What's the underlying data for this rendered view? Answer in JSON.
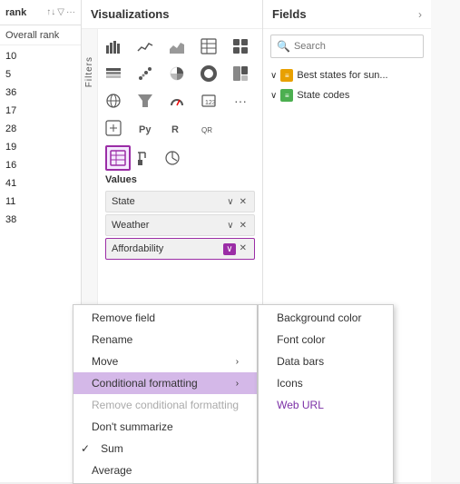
{
  "rank_panel": {
    "title": "rank",
    "subheader": "Overall rank",
    "values": [
      "10",
      "5",
      "36",
      "17",
      "28",
      "19",
      "16",
      "41",
      "11",
      "38"
    ]
  },
  "vis_panel": {
    "title": "Visualizations",
    "filters_label": "Filters",
    "values_label": "Values",
    "fields": [
      {
        "name": "State",
        "has_context": false
      },
      {
        "name": "Weather",
        "has_context": false
      },
      {
        "name": "Affordability",
        "has_context": true
      }
    ]
  },
  "fields_panel": {
    "title": "Fields",
    "search_placeholder": "Search",
    "groups": [
      {
        "label": "Best states for sun...",
        "icon_color": "#e8a000",
        "expanded": true,
        "subitems": []
      },
      {
        "label": "State codes",
        "icon_color": "#4CAF50",
        "expanded": false,
        "subitems": []
      }
    ]
  },
  "context_menu": {
    "items": [
      {
        "label": "Remove field",
        "type": "normal",
        "has_arrow": false,
        "disabled": false,
        "checked": false
      },
      {
        "label": "Rename",
        "type": "normal",
        "has_arrow": false,
        "disabled": false,
        "checked": false
      },
      {
        "label": "Move",
        "type": "normal",
        "has_arrow": true,
        "disabled": false,
        "checked": false
      },
      {
        "label": "Conditional formatting",
        "type": "highlighted",
        "has_arrow": true,
        "disabled": false,
        "checked": false
      },
      {
        "label": "Remove conditional formatting",
        "type": "normal",
        "has_arrow": false,
        "disabled": true,
        "checked": false
      },
      {
        "label": "Don't summarize",
        "type": "normal",
        "has_arrow": false,
        "disabled": false,
        "checked": false
      },
      {
        "label": "Sum",
        "type": "normal",
        "has_arrow": false,
        "disabled": false,
        "checked": true
      },
      {
        "label": "Average",
        "type": "normal",
        "has_arrow": false,
        "disabled": false,
        "checked": false
      }
    ]
  },
  "submenu": {
    "items": [
      {
        "label": "Background color",
        "style": "normal"
      },
      {
        "label": "Font color",
        "style": "normal"
      },
      {
        "label": "Data bars",
        "style": "normal"
      },
      {
        "label": "Icons",
        "style": "normal"
      },
      {
        "label": "Web URL",
        "style": "purple"
      }
    ]
  }
}
